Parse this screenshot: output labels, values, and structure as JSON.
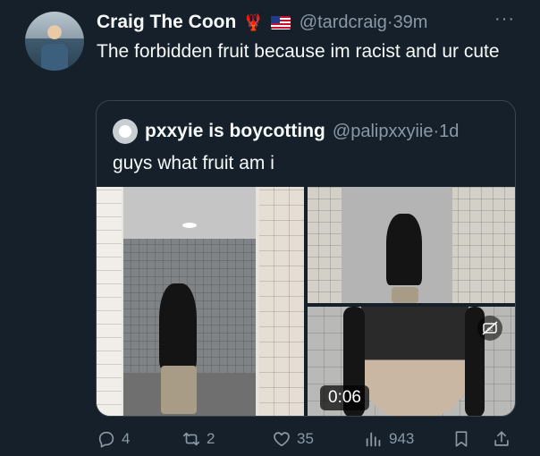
{
  "tweet": {
    "author_name": "Craig The Coon",
    "author_emoji": "🦞",
    "handle": "@tardcraig",
    "separator": "·",
    "time": "39m",
    "more": "···",
    "text": "The forbidden fruit because im racist and ur cute"
  },
  "quoted": {
    "author_name": "pxxyie is boycotting",
    "handle": "@palipxxyiie",
    "separator": "·",
    "time": "1d",
    "text": "guys what fruit am i",
    "video_duration": "0:06"
  },
  "actions": {
    "replies": "4",
    "retweets": "2",
    "likes": "35",
    "views": "943"
  },
  "colors": {
    "background": "#15202b",
    "text_primary": "#f7f9f9",
    "text_secondary": "#8b98a5",
    "border": "#38444d"
  },
  "icons": {
    "reply": "reply-icon",
    "retweet": "retweet-icon",
    "like": "heart-icon",
    "views": "views-icon",
    "bookmark": "bookmark-icon",
    "share": "share-icon",
    "captions": "captions-off-icon"
  }
}
